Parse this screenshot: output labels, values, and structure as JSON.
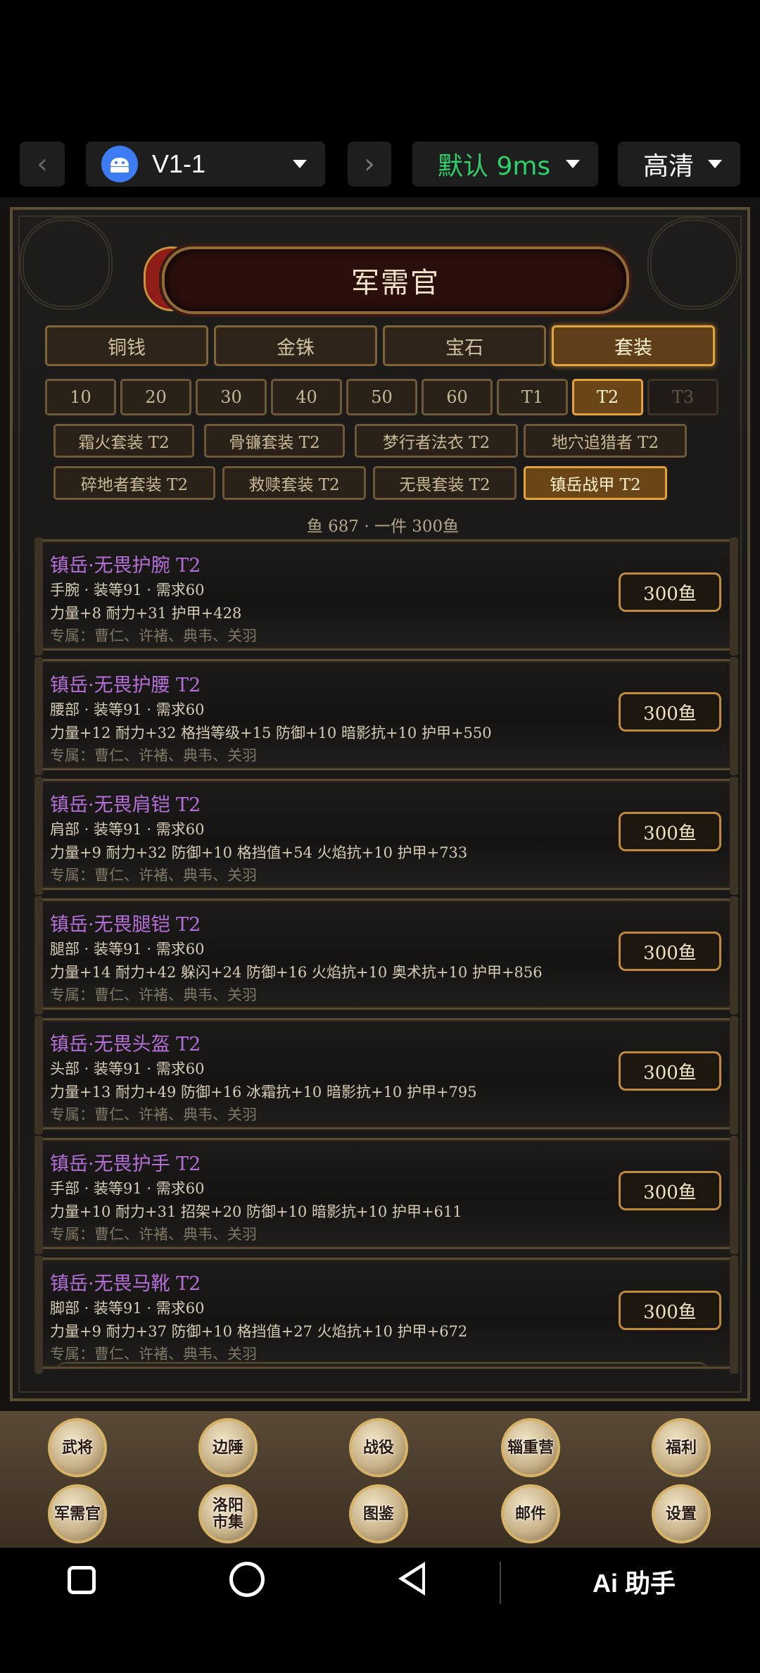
{
  "toolbar": {
    "device_label": "V1-1",
    "latency_label": "默认 9ms",
    "quality_label": "高清"
  },
  "game": {
    "title": "军需官",
    "main_tabs": [
      {
        "label": "铜钱",
        "active": false
      },
      {
        "label": "金铢",
        "active": false
      },
      {
        "label": "宝石",
        "active": false
      },
      {
        "label": "套装",
        "active": true
      }
    ],
    "tier_tabs": [
      {
        "label": "10",
        "state": "normal"
      },
      {
        "label": "20",
        "state": "normal"
      },
      {
        "label": "30",
        "state": "normal"
      },
      {
        "label": "40",
        "state": "normal"
      },
      {
        "label": "50",
        "state": "normal"
      },
      {
        "label": "60",
        "state": "normal"
      },
      {
        "label": "T1",
        "state": "normal"
      },
      {
        "label": "T2",
        "state": "active"
      },
      {
        "label": "T3",
        "state": "disabled"
      }
    ],
    "sets": [
      {
        "label": "霜火套装 T2",
        "active": false
      },
      {
        "label": "骨镰套装 T2",
        "active": false
      },
      {
        "label": "梦行者法衣 T2",
        "active": false
      },
      {
        "label": "地穴追猎者 T2",
        "active": false
      },
      {
        "label": "碎地者套装 T2",
        "active": false
      },
      {
        "label": "救赎套装 T2",
        "active": false
      },
      {
        "label": "无畏套装 T2",
        "active": false
      },
      {
        "label": "镇岳战甲 T2",
        "active": true
      }
    ],
    "currency_line": "鱼 687 · 一件 300鱼",
    "items": [
      {
        "name": "镇岳·无畏护腕 T2",
        "slot": "手腕 · 装等91 · 需求60",
        "stats": "力量+8 耐力+31 护甲+428",
        "exclusive": "专属：曹仁、许褚、典韦、关羽",
        "price": "300鱼"
      },
      {
        "name": "镇岳·无畏护腰 T2",
        "slot": "腰部 · 装等91 · 需求60",
        "stats": "力量+12 耐力+32 格挡等级+15 防御+10 暗影抗+10 护甲+550",
        "exclusive": "专属：曹仁、许褚、典韦、关羽",
        "price": "300鱼"
      },
      {
        "name": "镇岳·无畏肩铠 T2",
        "slot": "肩部 · 装等91 · 需求60",
        "stats": "力量+9 耐力+32 防御+10 格挡值+54 火焰抗+10 护甲+733",
        "exclusive": "专属：曹仁、许褚、典韦、关羽",
        "price": "300鱼"
      },
      {
        "name": "镇岳·无畏腿铠 T2",
        "slot": "腿部 · 装等91 · 需求60",
        "stats": "力量+14 耐力+42 躲闪+24 防御+16 火焰抗+10 奥术抗+10 护甲+856",
        "exclusive": "专属：曹仁、许褚、典韦、关羽",
        "price": "300鱼"
      },
      {
        "name": "镇岳·无畏头盔 T2",
        "slot": "头部 · 装等91 · 需求60",
        "stats": "力量+13 耐力+49 防御+16 冰霜抗+10 暗影抗+10 护甲+795",
        "exclusive": "专属：曹仁、许褚、典韦、关羽",
        "price": "300鱼"
      },
      {
        "name": "镇岳·无畏护手 T2",
        "slot": "手部 · 装等91 · 需求60",
        "stats": "力量+10 耐力+31 招架+20 防御+10 暗影抗+10 护甲+611",
        "exclusive": "专属：曹仁、许褚、典韦、关羽",
        "price": "300鱼"
      },
      {
        "name": "镇岳·无畏马靴 T2",
        "slot": "脚部 · 装等91 · 需求60",
        "stats": "力量+9 耐力+37 防御+10 格挡值+27 火焰抗+10 护甲+672",
        "exclusive": "专属：曹仁、许褚、典韦、关羽",
        "price": "300鱼"
      }
    ]
  },
  "bottom_nav": [
    {
      "label": "武将"
    },
    {
      "label": "边陲"
    },
    {
      "label": "战役"
    },
    {
      "label": "辎重营"
    },
    {
      "label": "福利"
    },
    {
      "label": "军需官"
    },
    {
      "label": "洛阳市集"
    },
    {
      "label": "图鉴"
    },
    {
      "label": "邮件"
    },
    {
      "label": "设置"
    }
  ],
  "system_nav": {
    "assistant_label": "Ai 助手"
  },
  "colors": {
    "accent_gold": "#e3a23e",
    "item_name_purple": "#b66fd8",
    "latency_green": "#2fd06a"
  }
}
